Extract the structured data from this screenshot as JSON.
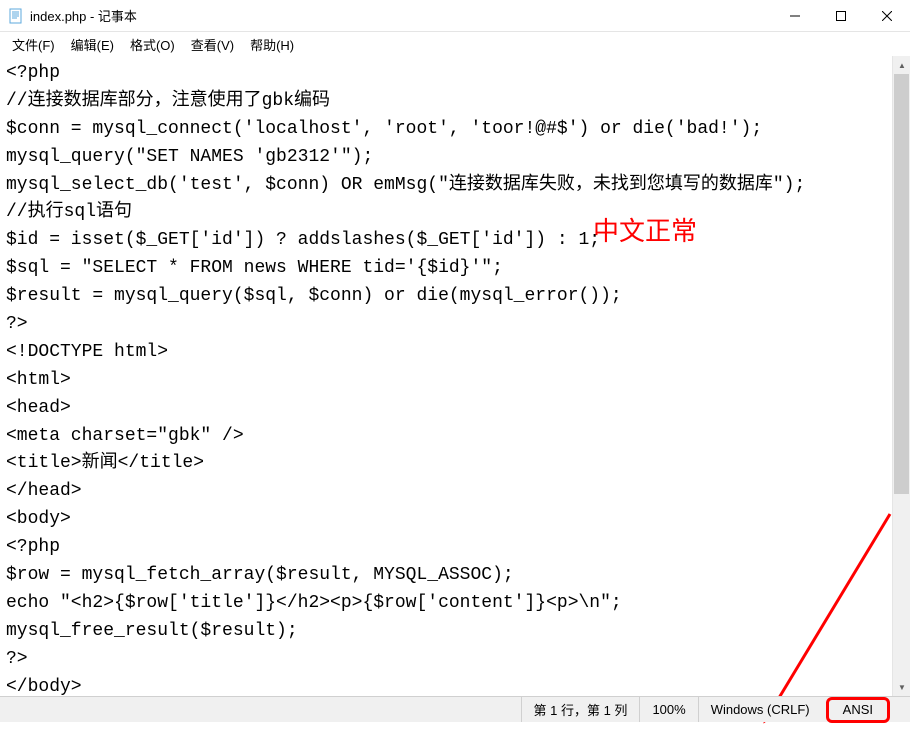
{
  "window": {
    "title": "index.php - 记事本"
  },
  "menu": {
    "file": "文件(F)",
    "edit": "编辑(E)",
    "format": "格式(O)",
    "view": "查看(V)",
    "help": "帮助(H)"
  },
  "editor": {
    "lines": [
      "<?php",
      "//连接数据库部分，注意使用了gbk编码",
      "$conn = mysql_connect('localhost', 'root', 'toor!@#$') or die('bad!');",
      "mysql_query(\"SET NAMES 'gb2312'\");",
      "mysql_select_db('test', $conn) OR emMsg(\"连接数据库失败，未找到您填写的数据库\");",
      "//执行sql语句",
      "$id = isset($_GET['id']) ? addslashes($_GET['id']) : 1;",
      "$sql = \"SELECT * FROM news WHERE tid='{$id}'\";",
      "$result = mysql_query($sql, $conn) or die(mysql_error());",
      "?>",
      "<!DOCTYPE html>",
      "<html>",
      "<head>",
      "<meta charset=\"gbk\" />",
      "<title>新闻</title>",
      "</head>",
      "<body>",
      "<?php",
      "$row = mysql_fetch_array($result, MYSQL_ASSOC);",
      "echo \"<h2>{$row['title']}</h2><p>{$row['content']}<p>\\n\";",
      "mysql_free_result($result);",
      "?>",
      "</body>"
    ]
  },
  "annotation": {
    "text": "中文正常"
  },
  "statusbar": {
    "position": "第 1 行，第 1 列",
    "zoom": "100%",
    "line_ending": "Windows (CRLF)",
    "encoding": "ANSI"
  }
}
